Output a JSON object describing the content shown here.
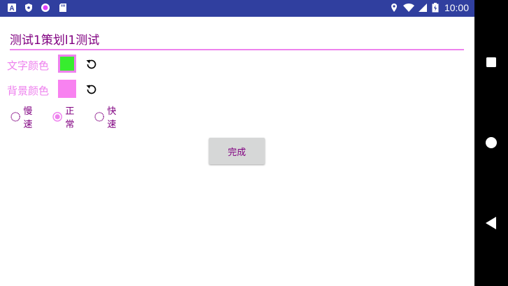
{
  "status_bar": {
    "time": "10:00",
    "icons": [
      "a-icon",
      "shield-icon",
      "record-icon",
      "sd-card-icon",
      "location-icon",
      "wifi-icon",
      "signal-icon",
      "battery-icon"
    ]
  },
  "form": {
    "title_value": "测试1策划l1测试",
    "text_color": {
      "label": "文字颜色",
      "color": "#37ed2e"
    },
    "bg_color": {
      "label": "背景颜色",
      "color": "#f882f0"
    },
    "speed_options": [
      {
        "label": "慢速",
        "selected": false
      },
      {
        "label": "正常",
        "selected": true
      },
      {
        "label": "快速",
        "selected": false
      }
    ],
    "done_label": "完成"
  },
  "nav_bar": {
    "buttons": [
      "recents-icon",
      "home-icon",
      "back-icon"
    ]
  },
  "colors": {
    "accent": "#ee82ee",
    "text": "#800080",
    "status_bar": "#303f9f"
  }
}
